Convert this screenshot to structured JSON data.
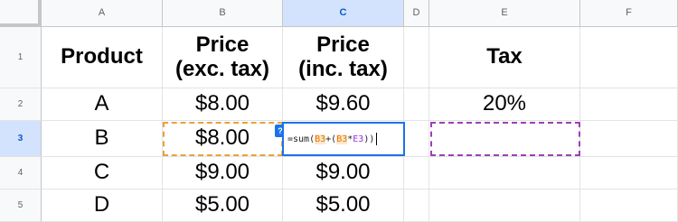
{
  "columns": [
    "A",
    "B",
    "C",
    "D",
    "E",
    "F"
  ],
  "rows": [
    "1",
    "2",
    "3",
    "4",
    "5"
  ],
  "cells": {
    "A1": "Product",
    "B1": "Price\n(exc. tax)",
    "C1": "Price\n(inc. tax)",
    "E1": "Tax",
    "A2": "A",
    "B2": "$8.00",
    "C2": "$9.60",
    "E2": "20%",
    "A3": "B",
    "B3": "$8.00",
    "A4": "C",
    "B4": "$9.00",
    "C4": "$9.00",
    "A5": "D",
    "B5": "$5.00",
    "C5": "$5.00"
  },
  "editor": {
    "help_icon": "?",
    "formula_parts": [
      "=sum(",
      "B3",
      "+(",
      "B3",
      "*",
      "E3",
      "))"
    ]
  },
  "selection": {
    "active_column": "C",
    "active_row": "3"
  },
  "colors": {
    "ref_orange": "#e37400",
    "ref_purple": "#9334e6",
    "selection_blue": "#1a73e8"
  }
}
